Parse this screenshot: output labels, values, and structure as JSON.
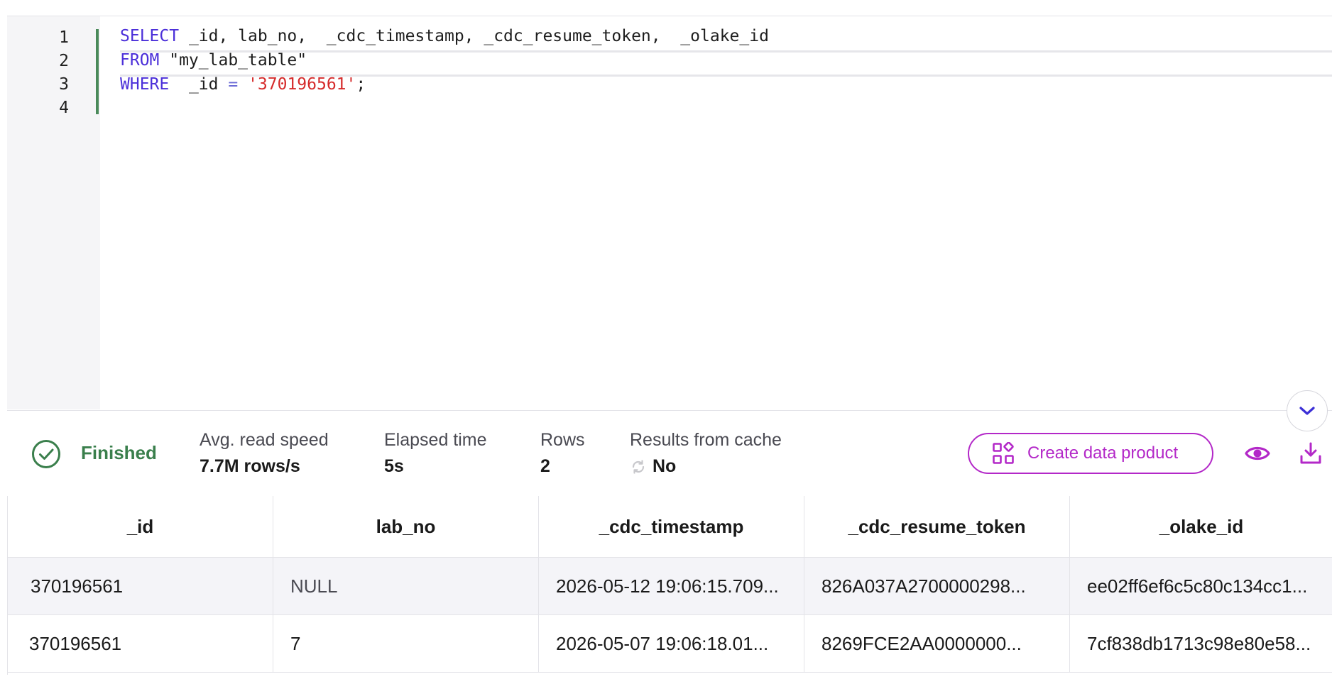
{
  "editor": {
    "line_numbers": [
      "1",
      "2",
      "3",
      "4"
    ],
    "lines": [
      {
        "kw": "SELECT",
        "rest": " _id, lab_no,  _cdc_timestamp, _cdc_resume_token,  _olake_id"
      },
      {
        "kw": "FROM",
        "rest": " \"my_lab_table\""
      },
      {
        "kw": "WHERE",
        "mid": "  _id ",
        "op": "=",
        "sp": " ",
        "str": "'370196561'",
        "end": ";"
      }
    ]
  },
  "status": {
    "state": "Finished",
    "metrics": [
      {
        "label": "Avg. read speed",
        "value": "7.7M rows/s"
      },
      {
        "label": "Elapsed time",
        "value": "5s"
      },
      {
        "label": "Rows",
        "value": "2"
      },
      {
        "label": "Results from cache",
        "value": "No"
      }
    ],
    "create_button": "Create data product"
  },
  "table": {
    "columns": [
      "_id",
      "lab_no",
      "_cdc_timestamp",
      "_cdc_resume_token",
      "_olake_id"
    ],
    "rows": [
      [
        "370196561",
        "NULL",
        "2026-05-12 19:06:15.709...",
        "826A037A2700000298...",
        "ee02ff6ef6c5c80c134cc1..."
      ],
      [
        "370196561",
        "7",
        "2026-05-07 19:06:18.01...",
        "8269FCE2AA0000000...",
        "7cf838db1713c98e80e58..."
      ]
    ]
  },
  "colors": {
    "accent": "#b328c8",
    "success": "#3a7f4c",
    "keyword": "#4b2fd9",
    "string": "#d52a2a"
  },
  "icons": {
    "status": "check-circle-icon",
    "cache": "refresh-icon",
    "create": "data-product-icon",
    "preview": "eye-icon",
    "download": "download-icon",
    "collapse": "chevron-down-icon"
  }
}
